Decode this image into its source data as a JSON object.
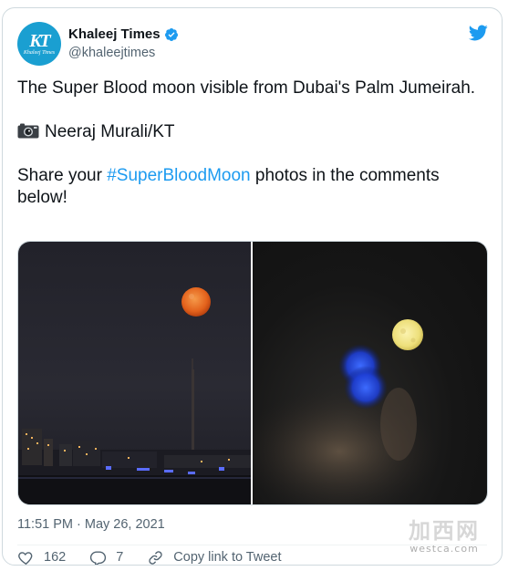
{
  "tweet": {
    "author": {
      "display_name": "Khaleej Times",
      "handle": "@khaleejtimes",
      "verified": true,
      "avatar_monogram": "KT",
      "avatar_subtext": "Khaleej Times",
      "avatar_color": "#1a9fd1"
    },
    "platform_icon": "twitter-bird-icon",
    "text": {
      "line1": "The Super Blood moon visible from Dubai's Palm Jumeirah.",
      "credit": "Neeraj Murali/KT",
      "credit_icon": "camera-icon",
      "share_prefix": "Share your ",
      "hashtag": "#SuperBloodMoon",
      "share_suffix": " photos in the comments below!"
    },
    "media": [
      {
        "name": "blood-moon-over-palm-jumeirah",
        "moon_color": "#e8631c"
      },
      {
        "name": "yellow-moon-with-blurred-lights",
        "moon_color": "#eddf7a"
      }
    ],
    "timestamp": "11:51 PM · May 26, 2021",
    "actions": {
      "likes": "162",
      "replies": "7",
      "copy_link": "Copy link to Tweet"
    },
    "accent_color": "#1d9bf0"
  },
  "watermark": {
    "text": "加西网",
    "url": "westca.com"
  }
}
